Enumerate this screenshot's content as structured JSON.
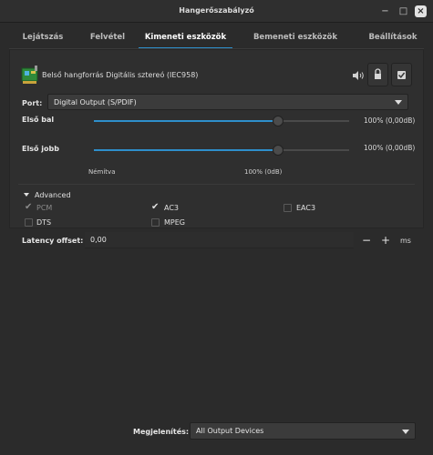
{
  "window": {
    "title": "Hangerőszabályzó"
  },
  "tabs": [
    {
      "label": "Lejátszás"
    },
    {
      "label": "Felvétel"
    },
    {
      "label": "Kimeneti eszközök"
    },
    {
      "label": "Bemeneti eszközök"
    },
    {
      "label": "Beállítások"
    }
  ],
  "active_tab": "Kimeneti eszközök",
  "device": {
    "name": "Belső hangforrás Digitális sztereó (IEC958)",
    "icon": "audio-card-icon",
    "muted": false,
    "locked": false,
    "set_as_fallback": true
  },
  "port": {
    "label": "Port:",
    "value": "Digital Output (S/PDIF)"
  },
  "channels": [
    {
      "label": "Első bal",
      "value_text": "100% (0,00dB)",
      "level": 0.72
    },
    {
      "label": "Első jobb",
      "value_text": "100% (0,00dB)",
      "level": 0.72
    }
  ],
  "scale_marks": {
    "muted": "Némítva",
    "hundred": "100% (0dB)"
  },
  "advanced": {
    "label": "Advanced",
    "formats": [
      {
        "name": "PCM",
        "checked": true,
        "disabled": true
      },
      {
        "name": "AC3",
        "checked": true,
        "disabled": false
      },
      {
        "name": "EAC3",
        "checked": false,
        "disabled": false
      },
      {
        "name": "DTS",
        "checked": false,
        "disabled": false
      },
      {
        "name": "MPEG",
        "checked": false,
        "disabled": false
      }
    ]
  },
  "latency": {
    "label": "Latency offset:",
    "value": "0,00",
    "minus": "−",
    "plus": "+",
    "unit": "ms"
  },
  "show": {
    "label": "Megjelenítés:",
    "value": "All Output Devices"
  },
  "colors": {
    "accent": "#2e8fcb",
    "background": "#2b2b2b",
    "panel": "#2f2f2f"
  }
}
